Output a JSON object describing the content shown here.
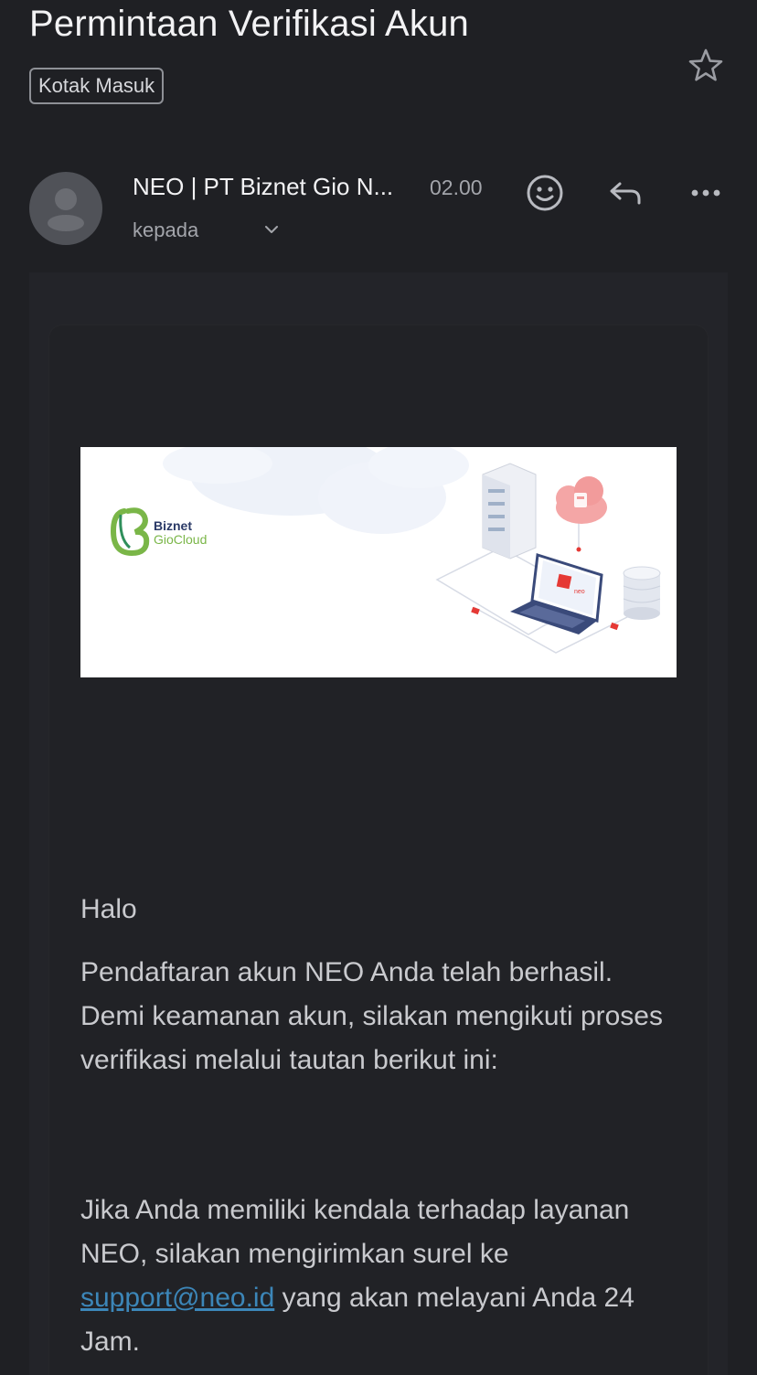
{
  "email": {
    "subject": "Permintaan Verifikasi Akun",
    "label": "Kotak Masuk",
    "sender": "NEO | PT Biznet Gio N...",
    "time": "02.00",
    "recipient_label": "kepada"
  },
  "body": {
    "greeting": "Halo",
    "paragraph1": "Pendaftaran akun NEO Anda telah berhasil. Demi keamanan akun, silakan mengikuti proses verifikasi melalui tautan berikut ini:",
    "paragraph2_before": "Jika Anda memiliki kendala terhadap layanan NEO, silakan mengirimkan surel ke ",
    "support_email": "support@neo.id",
    "paragraph2_after": " yang akan melayani Anda 24 Jam."
  },
  "banner": {
    "brand_line1": "Biznet",
    "brand_line2": "GioCloud",
    "screen_text": "neo"
  },
  "icons": {
    "star": "star-icon",
    "avatar": "person-icon",
    "chevron": "chevron-down-icon",
    "emoji": "smiley-icon",
    "reply": "reply-icon",
    "more": "more-horizontal-icon"
  },
  "colors": {
    "background": "#1f2024",
    "link": "#3c86b8",
    "brand_green": "#7ab648",
    "brand_red": "#e53935"
  }
}
